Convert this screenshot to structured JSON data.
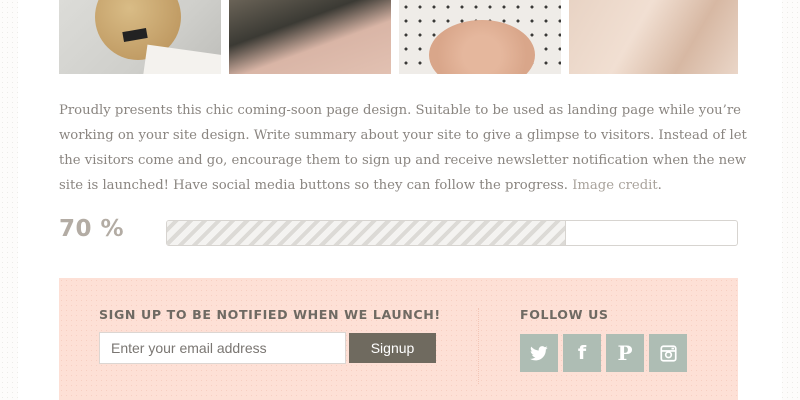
{
  "intro": {
    "text": "Proudly presents this chic coming-soon page design. Suitable to be used as landing page while you’re working on your site design. Write summary about your site to give a glimpse to visitors. Instead of let the visitors come and go, encourage them to sign up and receive newsletter notification when the new site is launched! Have social media buttons so they can follow the progress.",
    "credit_link": "Image credit",
    "end_punct": "."
  },
  "progress": {
    "label": "70 %",
    "value_percent": 70
  },
  "signup": {
    "heading": "SIGN UP TO BE NOTIFIED WHEN WE LAUNCH!",
    "email_placeholder": "Enter your email address",
    "button_label": "Signup"
  },
  "follow": {
    "heading": "FOLLOW US",
    "icons": [
      "twitter-icon",
      "facebook-icon",
      "pinterest-icon",
      "instagram-icon"
    ]
  },
  "fb_glyph": "f",
  "pin_glyph": "P",
  "colors": {
    "panel_bg": "#fde0d6",
    "button_bg": "#6f6a5f",
    "social_bg": "#aebdb4",
    "body_text": "#8a8580"
  }
}
